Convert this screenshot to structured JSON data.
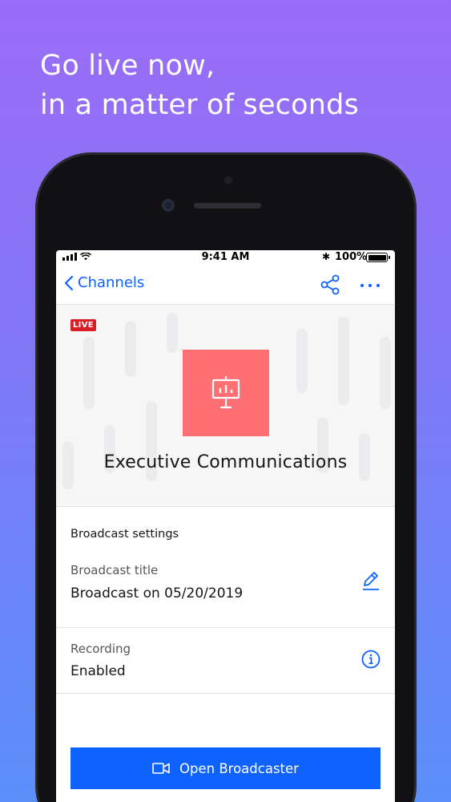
{
  "promo": {
    "headline_line1": "Go live now,",
    "headline_line2": "in a matter of seconds"
  },
  "status_bar": {
    "time": "9:41 AM",
    "battery": "100%",
    "icons": [
      "signal-icon",
      "wifi-icon",
      "bluetooth-icon",
      "battery-icon"
    ]
  },
  "nav": {
    "back_label": "Channels",
    "icons": [
      "chevron-left-icon",
      "share-icon",
      "more-icon"
    ]
  },
  "channel": {
    "live_badge": "LIVE",
    "name": "Executive Communications",
    "thumbnail_icon": "presentation-board-icon",
    "thumbnail_color": "#ff6f73"
  },
  "settings": {
    "heading": "Broadcast settings",
    "rows": [
      {
        "label": "Broadcast title",
        "value": "Broadcast on 05/20/2019",
        "icon": "edit-icon"
      },
      {
        "label": "Recording",
        "value": "Enabled",
        "icon": "info-icon"
      }
    ]
  },
  "actions": {
    "open_broadcaster": "Open Broadcaster",
    "open_broadcaster_icon": "video-camera-icon"
  },
  "colors": {
    "accent": "#0f62fe",
    "live": "#da1e28",
    "background_top": "#9b6cf6",
    "background_bottom": "#5b8ff9"
  }
}
